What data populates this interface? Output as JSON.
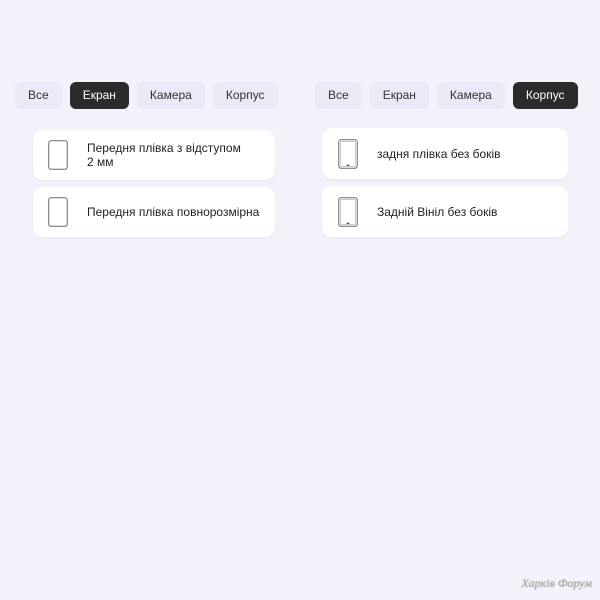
{
  "panels": [
    {
      "tabs": [
        {
          "label": "Все",
          "active": false
        },
        {
          "label": "Екран",
          "active": true
        },
        {
          "label": "Камера",
          "active": false
        },
        {
          "label": "Корпус",
          "active": false
        }
      ],
      "items": [
        {
          "icon": "phone-front-icon",
          "label": "Передня плівка з відступом\n2 мм"
        },
        {
          "icon": "phone-front-icon",
          "label": "Передня плівка повнорозмірна"
        }
      ]
    },
    {
      "tabs": [
        {
          "label": "Все",
          "active": false
        },
        {
          "label": "Екран",
          "active": false
        },
        {
          "label": "Камера",
          "active": false
        },
        {
          "label": "Корпус",
          "active": true
        }
      ],
      "items": [
        {
          "icon": "phone-back-icon",
          "label": "задня плівка без боків"
        },
        {
          "icon": "phone-back-icon",
          "label": "Задній Вініл без боків"
        }
      ]
    }
  ],
  "watermark": "Харків Форум",
  "colors": {
    "background": "#f3f2fa",
    "tab_inactive": "#ebe9f6",
    "tab_active": "#2b2b2b",
    "card": "#ffffff",
    "text": "#222222"
  }
}
